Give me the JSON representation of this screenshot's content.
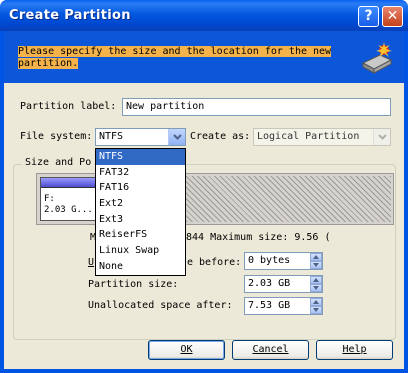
{
  "window": {
    "title": "Create Partition",
    "help_glyph": "?",
    "close_glyph": "✕"
  },
  "banner": {
    "text": "Please specify the size and the location for the new partition.",
    "icon": "disk-wizard-icon"
  },
  "form": {
    "label_caption": "Partition label:",
    "label_value": "New partition",
    "fs_caption": "File system:",
    "fs_value": "NTFS",
    "create_as_caption": "Create as:",
    "create_as_value": "Logical Partition"
  },
  "size_group": {
    "title": "Size and Po",
    "disk_part_line1": "F:",
    "disk_part_line2": "2.03 G...",
    "minmax_left": "M",
    "minmax_right": "844 Maximum size: 9.56 (",
    "unalloc_before_caption_u": "U",
    "unalloc_before_caption": "e before:",
    "unalloc_before_value": "0 bytes",
    "partition_size_caption": "Partition size:",
    "partition_size_value": "2.03 GB",
    "unalloc_after_caption": "Unallocated space after:",
    "unalloc_after_value": "7.53 GB"
  },
  "dropdown": {
    "options": [
      "NTFS",
      "FAT32",
      "FAT16",
      "Ext2",
      "Ext3",
      "ReiserFS",
      "Linux Swap",
      "None"
    ],
    "selected_index": 0
  },
  "buttons": {
    "ok": "OK",
    "cancel": "Cancel",
    "help": "Help"
  },
  "colors": {
    "title_blue": "#0054e3",
    "banner_blue": "#0c56d9",
    "highlight": "#f3b34a",
    "selection": "#316ac5",
    "face": "#ece9d8"
  }
}
